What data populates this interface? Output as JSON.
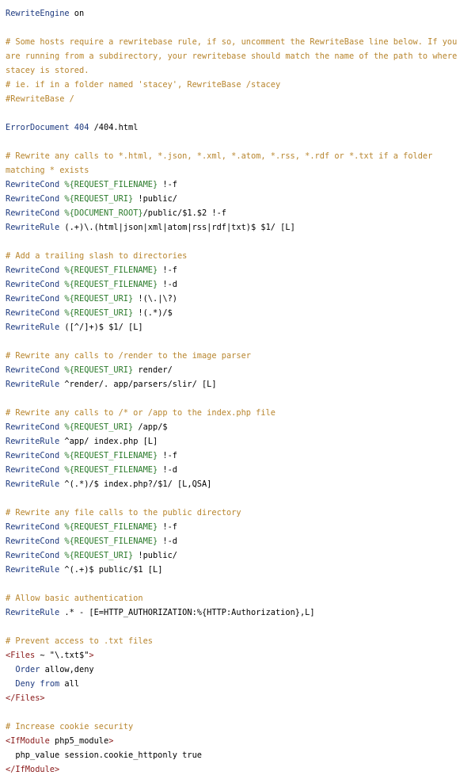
{
  "lines": [
    [
      [
        "dir",
        "RewriteEngine"
      ],
      [
        "txt",
        " on"
      ]
    ],
    [],
    [
      [
        "cm",
        "# Some hosts require a rewritebase rule, if so, uncomment the RewriteBase line below. If you are running from a subdirectory, your rewritebase should match the name of the path to where stacey is stored."
      ]
    ],
    [
      [
        "cm",
        "# ie. if in a folder named 'stacey', RewriteBase /stacey"
      ]
    ],
    [
      [
        "cm",
        "#RewriteBase /"
      ]
    ],
    [],
    [
      [
        "dir",
        "ErrorDocument"
      ],
      [
        "txt",
        " "
      ],
      [
        "dir",
        "404"
      ],
      [
        "txt",
        " /404.html"
      ]
    ],
    [],
    [
      [
        "cm",
        "# Rewrite any calls to *.html, *.json, *.xml, *.atom, *.rss, *.rdf or *.txt if a folder matching * exists"
      ]
    ],
    [
      [
        "dir",
        "RewriteCond"
      ],
      [
        "txt",
        " "
      ],
      [
        "var",
        "%{REQUEST_FILENAME}"
      ],
      [
        "txt",
        " !-f"
      ]
    ],
    [
      [
        "dir",
        "RewriteCond"
      ],
      [
        "txt",
        " "
      ],
      [
        "var",
        "%{REQUEST_URI}"
      ],
      [
        "txt",
        " !public/"
      ]
    ],
    [
      [
        "dir",
        "RewriteCond"
      ],
      [
        "txt",
        " "
      ],
      [
        "var",
        "%{DOCUMENT_ROOT}"
      ],
      [
        "txt",
        "/public/$1.$2 !-f"
      ]
    ],
    [
      [
        "dir",
        "RewriteRule"
      ],
      [
        "txt",
        " (.+)\\.(html|json|xml|atom|rss|rdf|txt)$ $1/ [L]"
      ]
    ],
    [],
    [
      [
        "cm",
        "# Add a trailing slash to directories"
      ]
    ],
    [
      [
        "dir",
        "RewriteCond"
      ],
      [
        "txt",
        " "
      ],
      [
        "var",
        "%{REQUEST_FILENAME}"
      ],
      [
        "txt",
        " !-f"
      ]
    ],
    [
      [
        "dir",
        "RewriteCond"
      ],
      [
        "txt",
        " "
      ],
      [
        "var",
        "%{REQUEST_FILENAME}"
      ],
      [
        "txt",
        " !-d"
      ]
    ],
    [
      [
        "dir",
        "RewriteCond"
      ],
      [
        "txt",
        " "
      ],
      [
        "var",
        "%{REQUEST_URI}"
      ],
      [
        "txt",
        " !(\\.|\\?)"
      ]
    ],
    [
      [
        "dir",
        "RewriteCond"
      ],
      [
        "txt",
        " "
      ],
      [
        "var",
        "%{REQUEST_URI}"
      ],
      [
        "txt",
        " !(.*)/$"
      ]
    ],
    [
      [
        "dir",
        "RewriteRule"
      ],
      [
        "txt",
        " ([^/]+)$ $1/ [L]"
      ]
    ],
    [],
    [
      [
        "cm",
        "# Rewrite any calls to /render to the image parser"
      ]
    ],
    [
      [
        "dir",
        "RewriteCond"
      ],
      [
        "txt",
        " "
      ],
      [
        "var",
        "%{REQUEST_URI}"
      ],
      [
        "txt",
        " render/"
      ]
    ],
    [
      [
        "dir",
        "RewriteRule"
      ],
      [
        "txt",
        " ^render/. app/parsers/slir/ [L]"
      ]
    ],
    [],
    [
      [
        "cm",
        "# Rewrite any calls to /* or /app to the index.php file"
      ]
    ],
    [
      [
        "dir",
        "RewriteCond"
      ],
      [
        "txt",
        " "
      ],
      [
        "var",
        "%{REQUEST_URI}"
      ],
      [
        "txt",
        " /app/$"
      ]
    ],
    [
      [
        "dir",
        "RewriteRule"
      ],
      [
        "txt",
        " ^app/ index.php [L]"
      ]
    ],
    [
      [
        "dir",
        "RewriteCond"
      ],
      [
        "txt",
        " "
      ],
      [
        "var",
        "%{REQUEST_FILENAME}"
      ],
      [
        "txt",
        " !-f"
      ]
    ],
    [
      [
        "dir",
        "RewriteCond"
      ],
      [
        "txt",
        " "
      ],
      [
        "var",
        "%{REQUEST_FILENAME}"
      ],
      [
        "txt",
        " !-d"
      ]
    ],
    [
      [
        "dir",
        "RewriteRule"
      ],
      [
        "txt",
        " ^(.*)/$ index.php?/$1/ [L,QSA]"
      ]
    ],
    [],
    [
      [
        "cm",
        "# Rewrite any file calls to the public directory"
      ]
    ],
    [
      [
        "dir",
        "RewriteCond"
      ],
      [
        "txt",
        " "
      ],
      [
        "var",
        "%{REQUEST_FILENAME}"
      ],
      [
        "txt",
        " !-f"
      ]
    ],
    [
      [
        "dir",
        "RewriteCond"
      ],
      [
        "txt",
        " "
      ],
      [
        "var",
        "%{REQUEST_FILENAME}"
      ],
      [
        "txt",
        " !-d"
      ]
    ],
    [
      [
        "dir",
        "RewriteCond"
      ],
      [
        "txt",
        " "
      ],
      [
        "var",
        "%{REQUEST_URI}"
      ],
      [
        "txt",
        " !public/"
      ]
    ],
    [
      [
        "dir",
        "RewriteRule"
      ],
      [
        "txt",
        " ^(.+)$ public/$1 [L]"
      ]
    ],
    [],
    [
      [
        "cm",
        "# Allow basic authentication"
      ]
    ],
    [
      [
        "dir",
        "RewriteRule"
      ],
      [
        "txt",
        " .* - [E=HTTP_AUTHORIZATION:%{HTTP:Authorization},L]"
      ]
    ],
    [],
    [
      [
        "cm",
        "# Prevent access to .txt files"
      ]
    ],
    [
      [
        "tag",
        "<Files"
      ],
      [
        "txt",
        " ~ \"\\.txt$\""
      ],
      [
        "tag",
        ">"
      ]
    ],
    [
      [
        "ind",
        "  "
      ],
      [
        "dir",
        "Order"
      ],
      [
        "txt",
        " allow,deny"
      ]
    ],
    [
      [
        "ind",
        "  "
      ],
      [
        "dir",
        "Deny"
      ],
      [
        "txt",
        " "
      ],
      [
        "dir",
        "from"
      ],
      [
        "txt",
        " all"
      ]
    ],
    [
      [
        "tag",
        "</Files>"
      ]
    ],
    [],
    [
      [
        "cm",
        "# Increase cookie security"
      ]
    ],
    [
      [
        "tag",
        "<IfModule"
      ],
      [
        "txt",
        " php5_module"
      ],
      [
        "tag",
        ">"
      ]
    ],
    [
      [
        "ind",
        "  "
      ],
      [
        "txt",
        "php_value session.cookie_httponly true"
      ]
    ],
    [
      [
        "tag",
        "</IfModule>"
      ]
    ]
  ]
}
